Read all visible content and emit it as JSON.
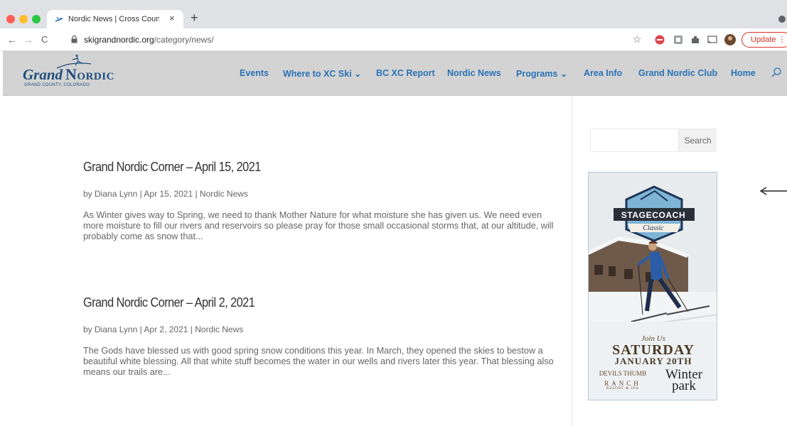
{
  "browser": {
    "tab_title": "Nordic News | Cross Country S",
    "tab_close": "×",
    "new_tab": "+",
    "nav_back": "←",
    "nav_forward": "→",
    "nav_reload": "C",
    "url_host": "skigrandnordic.org",
    "url_path": "/category/news/",
    "bookmark_star": "☆",
    "update_label": "Update",
    "update_menu": "⋮"
  },
  "header": {
    "logo_grand": "Grand",
    "logo_nordic": "Nordic",
    "logo_sub": "GRAND COUNTY, COLORADO",
    "nav": [
      {
        "label": "Events"
      },
      {
        "label": "Where to XC Ski ⌄"
      },
      {
        "label": "BC XC Report"
      },
      {
        "label": "Nordic News"
      },
      {
        "label": "Programs ⌄"
      },
      {
        "label": "Area Info"
      },
      {
        "label": "Grand Nordic Club"
      },
      {
        "label": "Home"
      }
    ]
  },
  "posts": [
    {
      "title": "Grand Nordic Corner – April 15, 2021",
      "meta": "by Diana Lynn | Apr 15, 2021 | Nordic News",
      "excerpt": "As Winter gives way to Spring, we need to thank Mother Nature for what moisture she has given us.  We need even more moisture to fill our rivers and reservoirs so please pray for those small occasional storms that, at our altitude, will probably come as snow that..."
    },
    {
      "title": "Grand Nordic Corner – April 2, 2021",
      "meta": "by Diana Lynn | Apr 2, 2021 | Nordic News",
      "excerpt": "The Gods have blessed us with good spring snow conditions this year.  In March, they opened the skies to bestow a beautiful white blessing.  All that white stuff becomes the water in our wells and rivers later this year.  That blessing also means our trails are..."
    }
  ],
  "sidebar": {
    "search_button": "Search",
    "search_value": "",
    "ad": {
      "badge_title": "STAGECOACH",
      "badge_sub": "Classic",
      "join": "Join Us",
      "day": "SATURDAY",
      "date": "JANUARY 20TH",
      "sponsor1_line1": "DEVILS THUMB",
      "sponsor1_line2": "RANCH",
      "sponsor1_line3": "RESORT & SPA",
      "sponsor2_line1": "Winter",
      "sponsor2_line2": "park"
    }
  },
  "colors": {
    "nav_link": "#2a72b5",
    "header_bg": "#d3d3d3",
    "logo_blue": "#1e4e7c",
    "update_red": "#d93025"
  }
}
